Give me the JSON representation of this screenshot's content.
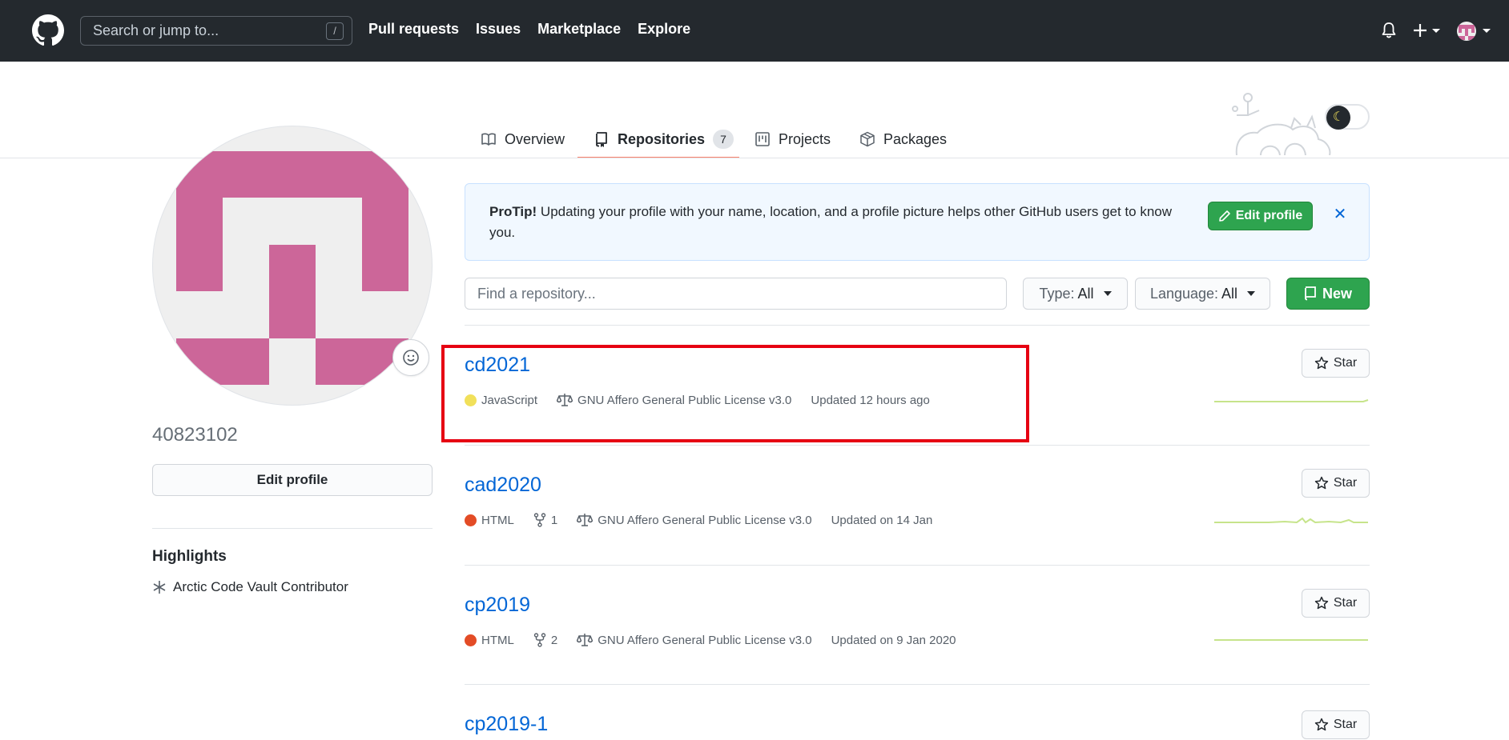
{
  "header": {
    "search_placeholder": "Search or jump to...",
    "search_key": "/",
    "nav": [
      "Pull requests",
      "Issues",
      "Marketplace",
      "Explore"
    ],
    "icons": [
      "github-logo-icon",
      "bell-icon",
      "plus-icon",
      "avatar-icon"
    ]
  },
  "tabs": {
    "overview": "Overview",
    "repositories": "Repositories",
    "repositories_count": "7",
    "projects": "Projects",
    "packages": "Packages",
    "active": "Repositories"
  },
  "profile": {
    "username": "40823102",
    "edit_button": "Edit profile",
    "highlights_title": "Highlights",
    "highlight_item": "Arctic Code Vault Contributor",
    "avatar_color": "#cc6699"
  },
  "protip": {
    "label": "ProTip!",
    "text": " Updating your profile with your name, location, and a profile picture helps other GitHub users get to know you.",
    "button": "Edit profile",
    "close": "✕"
  },
  "filters": {
    "find_placeholder": "Find a repository...",
    "type_label": "Type:",
    "type_value": "All",
    "language_label": "Language:",
    "language_value": "All",
    "new_button": "New"
  },
  "repos": [
    {
      "name": "cd2021",
      "language": "JavaScript",
      "language_color": "#f1e05a",
      "forks": "",
      "license": "GNU Affero General Public License v3.0",
      "updated": "Updated 12 hours ago",
      "star": "Star"
    },
    {
      "name": "cad2020",
      "language": "HTML",
      "language_color": "#e34c26",
      "forks": "1",
      "license": "GNU Affero General Public License v3.0",
      "updated": "Updated on 14 Jan",
      "star": "Star"
    },
    {
      "name": "cp2019",
      "language": "HTML",
      "language_color": "#e34c26",
      "forks": "2",
      "license": "GNU Affero General Public License v3.0",
      "updated": "Updated on 9 Jan 2020",
      "star": "Star"
    },
    {
      "name": "cp2019-1",
      "star": "Star"
    }
  ],
  "colors": {
    "header_bg": "#24292e",
    "link": "#0366d6",
    "green": "#2ea44f",
    "highlight_box": "#e60012"
  }
}
